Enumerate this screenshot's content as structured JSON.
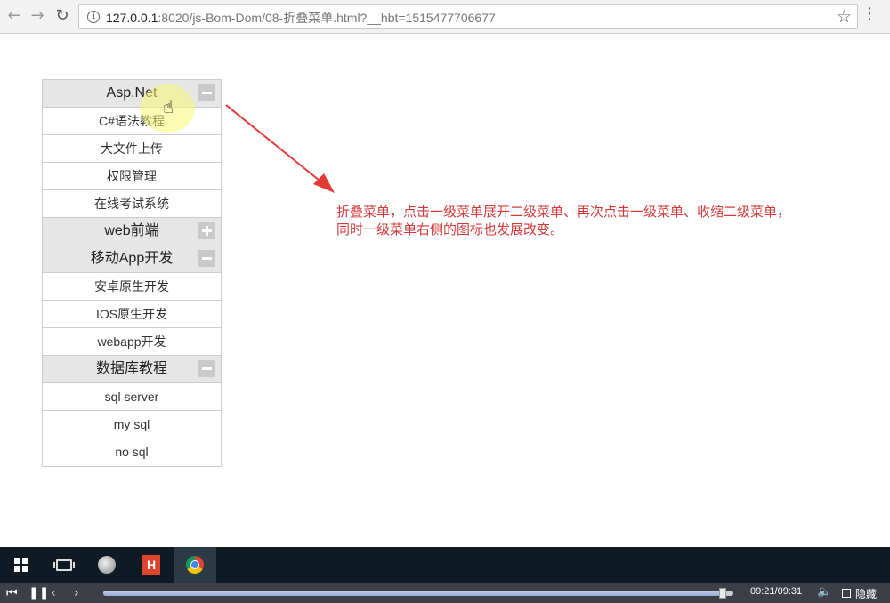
{
  "browser": {
    "url_host": "127.0.0.1",
    "url_rest": ":8020/js-Bom-Dom/08-折叠菜单.html?__hbt=1515477706677"
  },
  "menu": [
    {
      "title": "Asp.Net",
      "expanded": true,
      "items": [
        "C#语法教程",
        "大文件上传",
        "权限管理",
        "在线考试系统"
      ]
    },
    {
      "title": "web前端",
      "expanded": false,
      "items": []
    },
    {
      "title": "移动App开发",
      "expanded": true,
      "items": [
        "安卓原生开发",
        "IOS原生开发",
        "webapp开发"
      ]
    },
    {
      "title": "数据库教程",
      "expanded": true,
      "items": [
        "sql server",
        "my sql",
        "no sql"
      ]
    }
  ],
  "annotation": {
    "line1": "折叠菜单，点击一级菜单展开二级菜单、再次点击一级菜单、收缩二级菜单，",
    "line2": "同时一级菜单右侧的图标也发展改变。",
    "color": "#d23a3a"
  },
  "player": {
    "time": "09:21/09:31",
    "progress": 0.983,
    "hide_label": "隐藏"
  },
  "taskbar": {
    "apps": [
      "windows-start-icon",
      "task-view-icon",
      "speaker-app-icon",
      "hbuilder-icon",
      "chrome-icon"
    ],
    "hbuilder_letter": "H"
  }
}
